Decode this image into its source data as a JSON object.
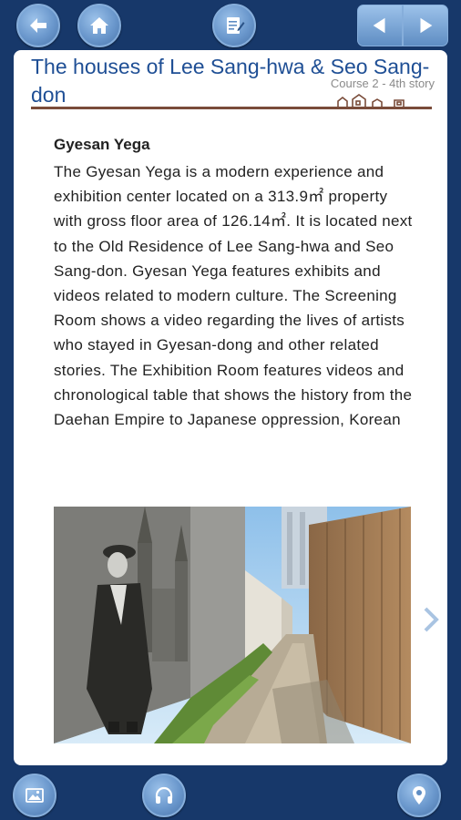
{
  "title": "The houses of Lee Sang-hwa & Seo Sang-don",
  "subtitle": "Course 2 - 4th story",
  "article": {
    "heading": "Gyesan Yega",
    "body": "The Gyesan Yega is a modern experience and exhibition center located on a 313.9㎡ property with gross floor area of 126.14㎡. It is located next to the Old Residence of Lee Sang-hwa and Seo Sang-don. Gyesan Yega features exhibits and videos related to modern culture. The Screening Room shows a video regarding the lives of artists who stayed in Gyesan-dong and other related stories. The Exhibition Room features videos and chronological table that shows the history from the Daehan Empire to Japanese oppression, Korean"
  },
  "icons": {
    "back": "back-arrow-icon",
    "home": "home-icon",
    "notes": "notepad-icon",
    "prev": "triangle-left-icon",
    "next": "triangle-right-icon",
    "gallery": "picture-icon",
    "audio": "headphones-icon",
    "map": "map-pin-icon",
    "slide_next": "chevron-right-icon"
  },
  "colors": {
    "frame": "#17386a",
    "button": "#6a97cc",
    "title": "#1f4f95",
    "rule": "#7a4c3a"
  }
}
